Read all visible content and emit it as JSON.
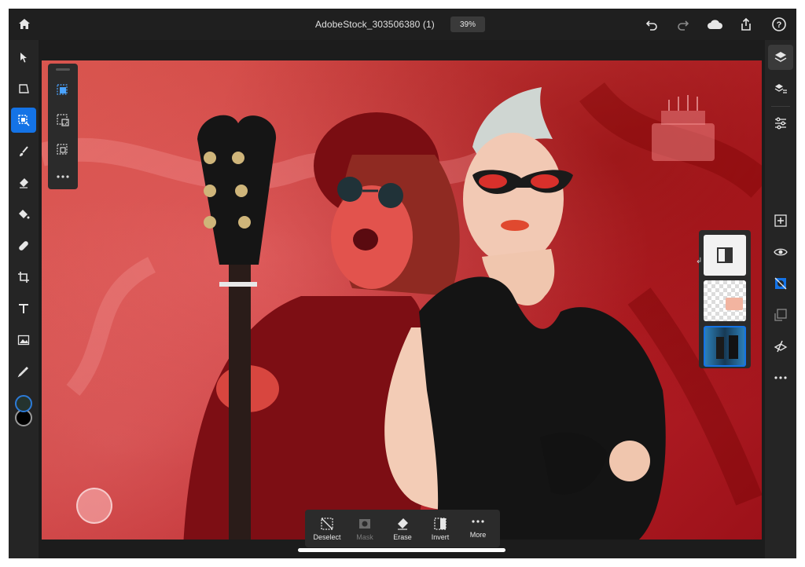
{
  "document": {
    "title": "AdobeStock_303506380 (1)",
    "zoom": "39%"
  },
  "topbar": {
    "icons": [
      "home-icon",
      "undo-icon",
      "redo-icon",
      "cloud-icon",
      "share-icon",
      "help-icon"
    ]
  },
  "left_toolbar": {
    "tools": [
      "move-tool-icon",
      "transform-tool-icon",
      "selection-tool-icon",
      "brush-tool-icon",
      "eraser-tool-icon",
      "fill-tool-icon",
      "healing-tool-icon",
      "crop-tool-icon",
      "type-tool-icon",
      "place-image-icon",
      "eyedropper-icon"
    ],
    "active_tool": "selection-tool-icon",
    "foreground_color": "#24332f",
    "background_color": "#000000"
  },
  "selection_panel": {
    "items": [
      "select-subject-icon",
      "select-area-icon",
      "select-similar-icon",
      "more-options-icon"
    ]
  },
  "right_toolbar": {
    "items": [
      "layers-icon",
      "layer-properties-icon",
      "adjustments-icon",
      "add-layer-icon",
      "visibility-icon",
      "mask-icon",
      "merge-icon",
      "clipping-icon",
      "more-icon"
    ]
  },
  "layers_panel": {
    "layers": [
      "adjustment-layer",
      "cake-layer",
      "photo-layer"
    ],
    "selected_layer": "photo-layer"
  },
  "action_bar": {
    "deselect": "Deselect",
    "mask": "Mask",
    "erase": "Erase",
    "invert": "Invert",
    "more": "More"
  },
  "colors": {
    "accent": "#1473e6",
    "canvas_tint": "#c8393a"
  }
}
